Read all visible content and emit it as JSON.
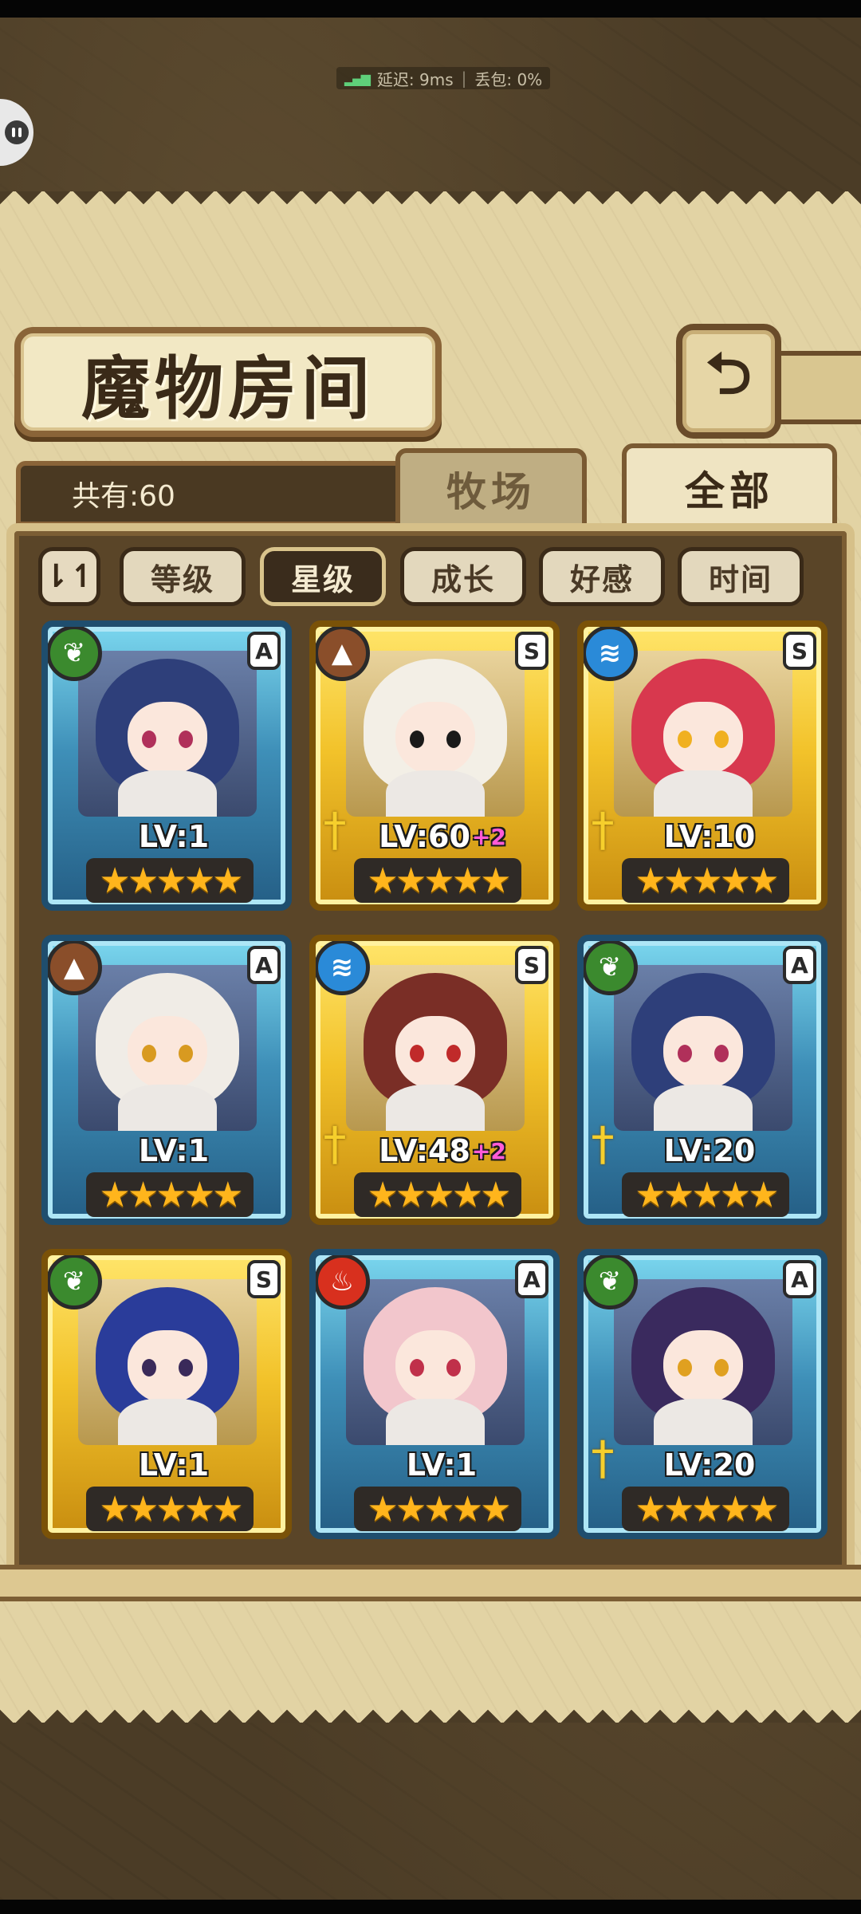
{
  "status_overlay": {
    "latency": "延迟: 9ms",
    "packet_loss": "丢包: 0%"
  },
  "title": "魔物房间",
  "back_icon": "back-arrow-icon",
  "count_label": "共有:60",
  "tabs": [
    {
      "label": "牧场",
      "active": false
    },
    {
      "label": "全部",
      "active": true
    }
  ],
  "sort_buttons": [
    {
      "label": "等级",
      "active": false
    },
    {
      "label": "星级",
      "active": true
    },
    {
      "label": "成长",
      "active": false
    },
    {
      "label": "好感",
      "active": false
    },
    {
      "label": "时间",
      "active": false
    }
  ],
  "sort_toggle_symbol": "⇂↿",
  "colors": {
    "panel": "#e2d3a4",
    "frame_dark": "#5a4528",
    "rarity_A": "#3e8fb8",
    "rarity_S": "#f2c22a",
    "star": "#ffb51c",
    "enhance_plus": "#ff5bd6"
  },
  "monsters": [
    {
      "element": "leaf",
      "element_symbol": "❦",
      "grade": "A",
      "level": "LV:1",
      "plus": "",
      "stars": "★★★★★",
      "equipped": false,
      "hair": "#2e3f7a",
      "eye": "#b0305a"
    },
    {
      "element": "earth",
      "element_symbol": "▲",
      "grade": "S",
      "level": "LV:60",
      "plus": "+2",
      "stars": "★★★★★",
      "equipped": true,
      "hair": "#f3efe6",
      "eye": "#1a1a1a"
    },
    {
      "element": "water",
      "element_symbol": "≋",
      "grade": "S",
      "level": "LV:10",
      "plus": "",
      "stars": "★★★★★",
      "equipped": true,
      "hair": "#d8384e",
      "eye": "#f0b020"
    },
    {
      "element": "earth",
      "element_symbol": "▲",
      "grade": "A",
      "level": "LV:1",
      "plus": "",
      "stars": "★★★★★",
      "equipped": false,
      "hair": "#f0ece6",
      "eye": "#d89a20"
    },
    {
      "element": "water",
      "element_symbol": "≋",
      "grade": "S",
      "level": "LV:48",
      "plus": "+2",
      "stars": "★★★★★",
      "equipped": true,
      "hair": "#7a2e26",
      "eye": "#c02a2a"
    },
    {
      "element": "leaf",
      "element_symbol": "❦",
      "grade": "A",
      "level": "LV:20",
      "plus": "",
      "stars": "★★★★★",
      "equipped": true,
      "hair": "#2e3f7a",
      "eye": "#b0305a"
    },
    {
      "element": "leaf",
      "element_symbol": "❦",
      "grade": "S",
      "level": "LV:1",
      "plus": "",
      "stars": "★★★★★",
      "equipped": false,
      "hair": "#2a3c9a",
      "eye": "#3a2a5a"
    },
    {
      "element": "fire",
      "element_symbol": "♨",
      "grade": "A",
      "level": "LV:1",
      "plus": "",
      "stars": "★★★★★",
      "equipped": false,
      "hair": "#f2c6cc",
      "eye": "#c0304a"
    },
    {
      "element": "leaf",
      "element_symbol": "❦",
      "grade": "A",
      "level": "LV:20",
      "plus": "",
      "stars": "★★★★★",
      "equipped": true,
      "hair": "#3a2a5e",
      "eye": "#e0a020"
    }
  ]
}
